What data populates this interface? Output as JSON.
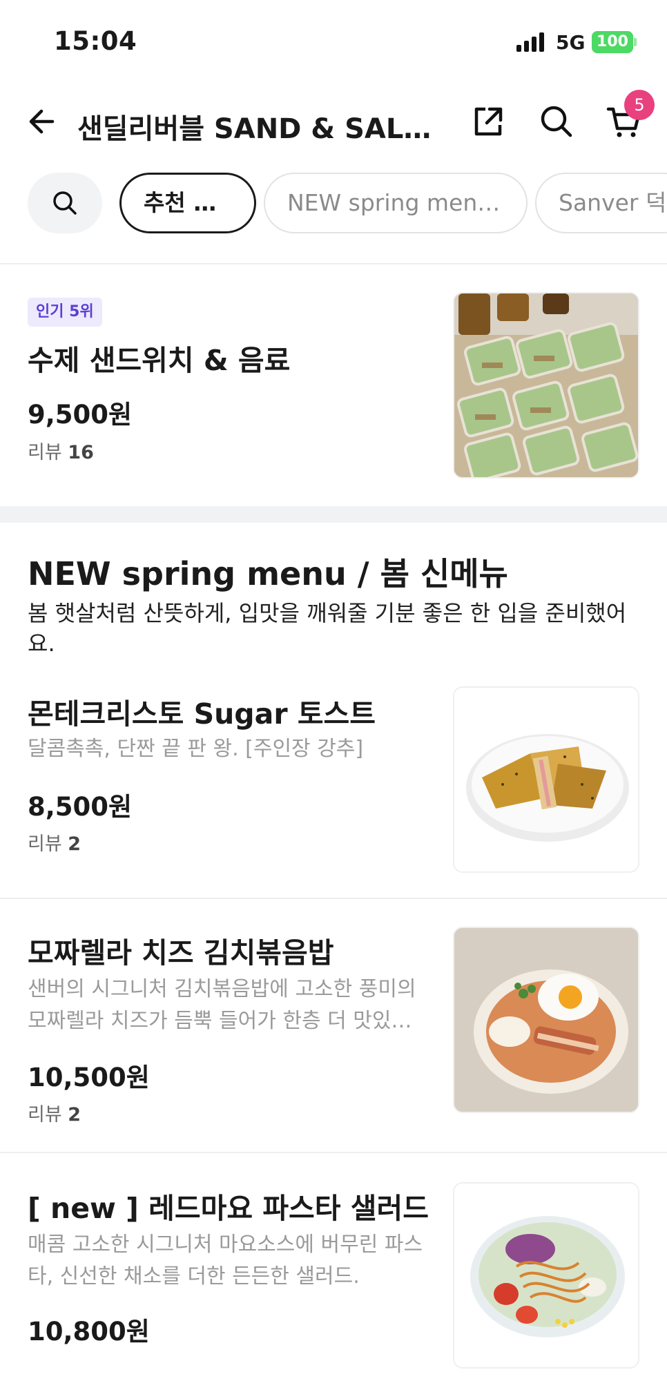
{
  "status_bar": {
    "time": "15:04",
    "network": "5G",
    "battery": "100"
  },
  "header": {
    "title": "샌딜리버블 SAND & SALAD…",
    "cart_count": "5"
  },
  "categories": {
    "chips": [
      "추천 메뉴",
      "NEW spring men…",
      "Sanver 덕"
    ],
    "active_index": 0
  },
  "recommended": {
    "badge": "인기 5위",
    "name": "수제 샌드위치 & 음료",
    "price": "9,500원",
    "review_label": "리뷰",
    "review_count": "16"
  },
  "section": {
    "title": "NEW spring menu / 봄 신메뉴",
    "description": "봄 햇살처럼 산뜻하게, 입맛을 깨워줄 기분 좋은 한 입을 준비했어요."
  },
  "items": [
    {
      "name": "몬테크리스토 Sugar 토스트",
      "desc": "달콤촉촉, 단짠 끝 판 왕. [주인장 강추]",
      "price": "8,500원",
      "review_label": "리뷰",
      "review_count": "2"
    },
    {
      "name": "모짜렐라 치즈 김치볶음밥",
      "desc": "샌버의 시그니처 김치볶음밥에 고소한 풍미의 모짜렐라 치즈가 듬뿍 들어가 한층 더 맛있…",
      "price": "10,500원",
      "review_label": "리뷰",
      "review_count": "2"
    },
    {
      "name": "[ new ] 레드마요 파스타 샐러드",
      "desc": "매콤 고소한 시그니처 마요소스에 버무린 파스타, 신선한 채소를 더한 든든한 샐러드.",
      "price": "10,800원"
    }
  ],
  "colors": {
    "accent_badge": "#e8417d",
    "popular_badge_bg": "#eeeafd",
    "popular_badge_text": "#5b3fd6",
    "battery": "#4cd964"
  }
}
